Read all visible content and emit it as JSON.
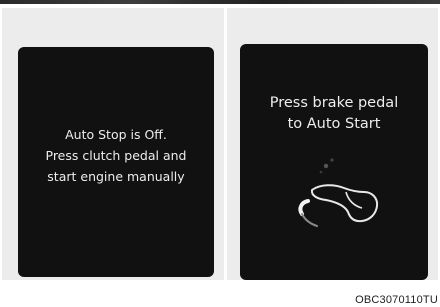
{
  "left_panel": {
    "message_lines": [
      "Auto Stop is Off.",
      "Press clutch pedal and",
      "start engine manually"
    ]
  },
  "right_panel": {
    "message_lines": [
      "Press brake pedal",
      "to Auto Start"
    ],
    "icon": "foot-on-brake-pedal-icon"
  },
  "figure_code": "OBC3070110TU",
  "colors": {
    "screen_background": "#111111",
    "panel_background": "#ececec",
    "text": "#ededed"
  }
}
